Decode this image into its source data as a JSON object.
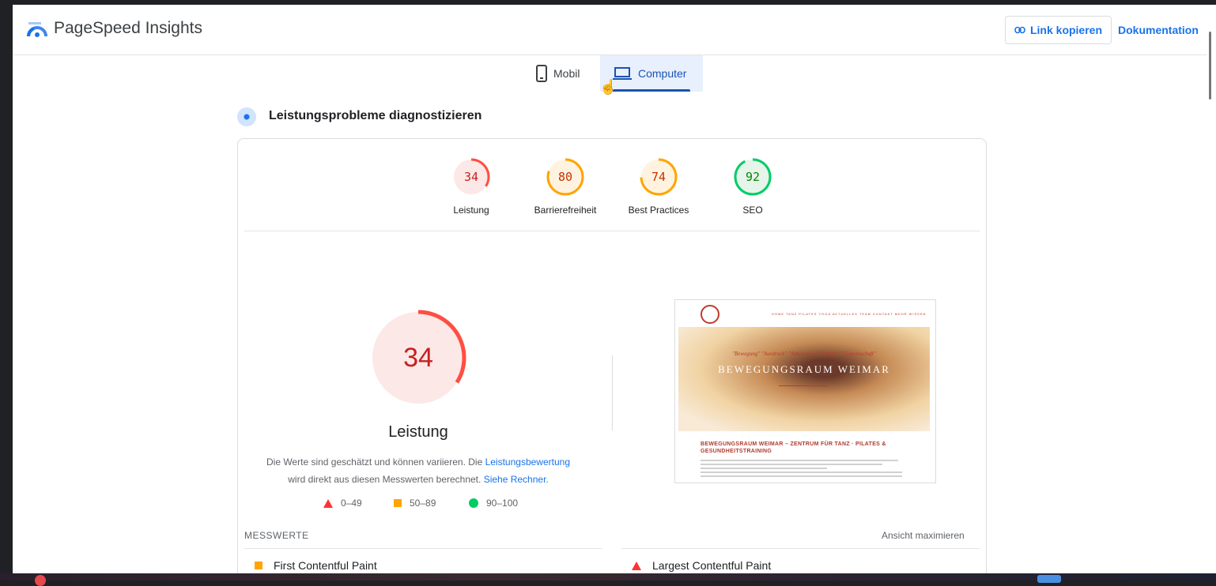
{
  "header": {
    "brand": "PageSpeed Insights",
    "copy_link": "Link kopieren",
    "documentation": "Dokumentation"
  },
  "tabs": [
    {
      "label": "Mobil",
      "icon": "phone-icon",
      "selected": false
    },
    {
      "label": "Computer",
      "icon": "laptop-icon",
      "selected": true
    }
  ],
  "section_title": "Leistungsprobleme diagnostizieren",
  "scores": [
    {
      "value": "34",
      "label": "Leistung",
      "status": "fail",
      "color": "#c5221f"
    },
    {
      "value": "80",
      "label": "Barrierefreiheit",
      "status": "average",
      "color": "#c33300"
    },
    {
      "value": "74",
      "label": "Best Practices",
      "status": "average",
      "color": "#c33300"
    },
    {
      "value": "92",
      "label": "SEO",
      "status": "pass",
      "color": "#008800"
    }
  ],
  "main_score": {
    "value": "34",
    "title": "Leistung",
    "desc_part1": "Die Werte sind geschätzt und können variieren. Die ",
    "desc_link1": "Leistungsbewertung",
    "desc_part2": " wird direkt aus diesen Messwerten berechnet. ",
    "desc_link2": "Siehe Rechner",
    "desc_part3": "."
  },
  "legend": [
    {
      "shape": "triangle",
      "range": "0–49",
      "color": "#ff3333"
    },
    {
      "shape": "square",
      "range": "50–89",
      "color": "#ffa400"
    },
    {
      "shape": "circle",
      "range": "90–100",
      "color": "#00cc66"
    }
  ],
  "screenshot": {
    "nav_text": "HOME   TANZ   PILATES   YOGA   AKTUELLES   TEAM   KONTAKT   MEHR WISSEN",
    "tagline": "\"Bewegung\" \"Ausdruck\" \"Ankommen\" \"Einheit\" \"Gemeinschaft\"",
    "hero_title": "BEWEGUNGSRAUM WEIMAR",
    "heading": "BEWEGUNGSRAUM WEIMAR – ZENTRUM FÜR TANZ · PILATES & GESUNDHEITSTRAINING"
  },
  "metrics": {
    "heading": "MESSWERTE",
    "maximize": "Ansicht maximieren",
    "items": [
      {
        "label": "First Contentful Paint",
        "status": "average"
      },
      {
        "label": "Largest Contentful Paint",
        "status": "fail"
      }
    ]
  }
}
